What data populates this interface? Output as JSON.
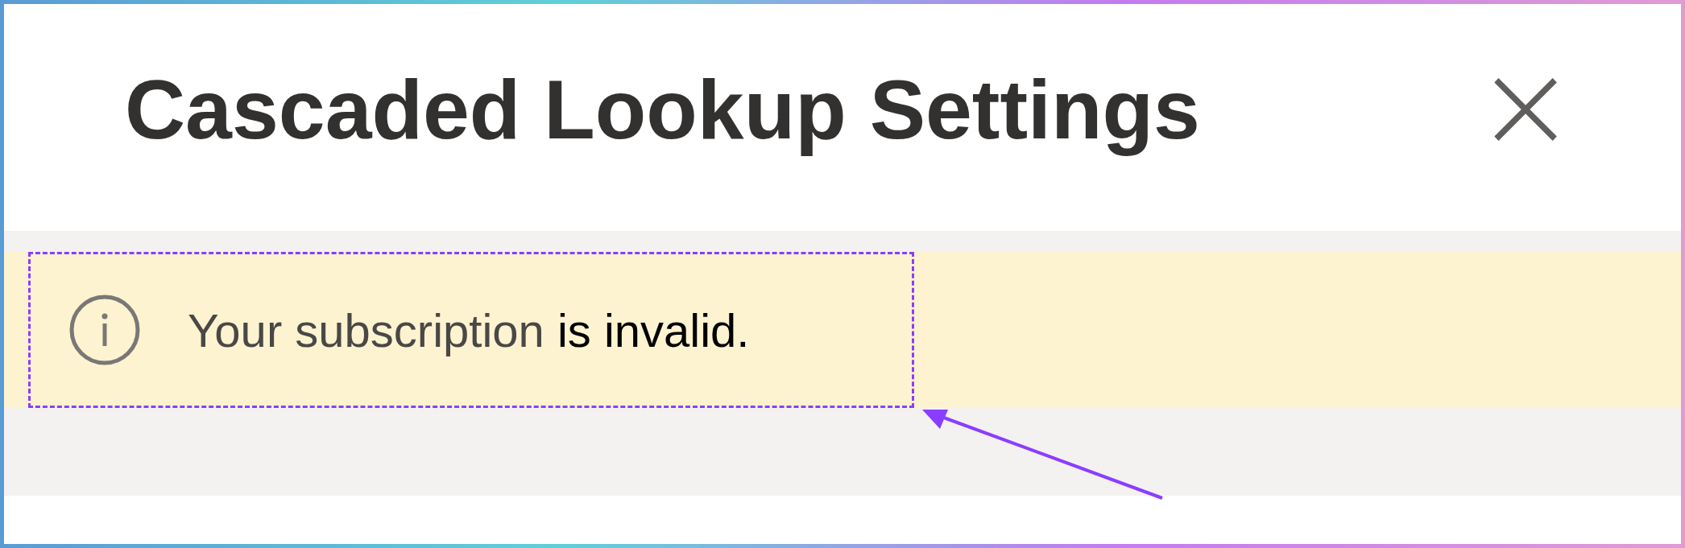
{
  "dialog": {
    "title": "Cascaded Lookup Settings",
    "close_symbol": "×"
  },
  "notice": {
    "lead": "Your subscription",
    "rest": "is invalid."
  }
}
